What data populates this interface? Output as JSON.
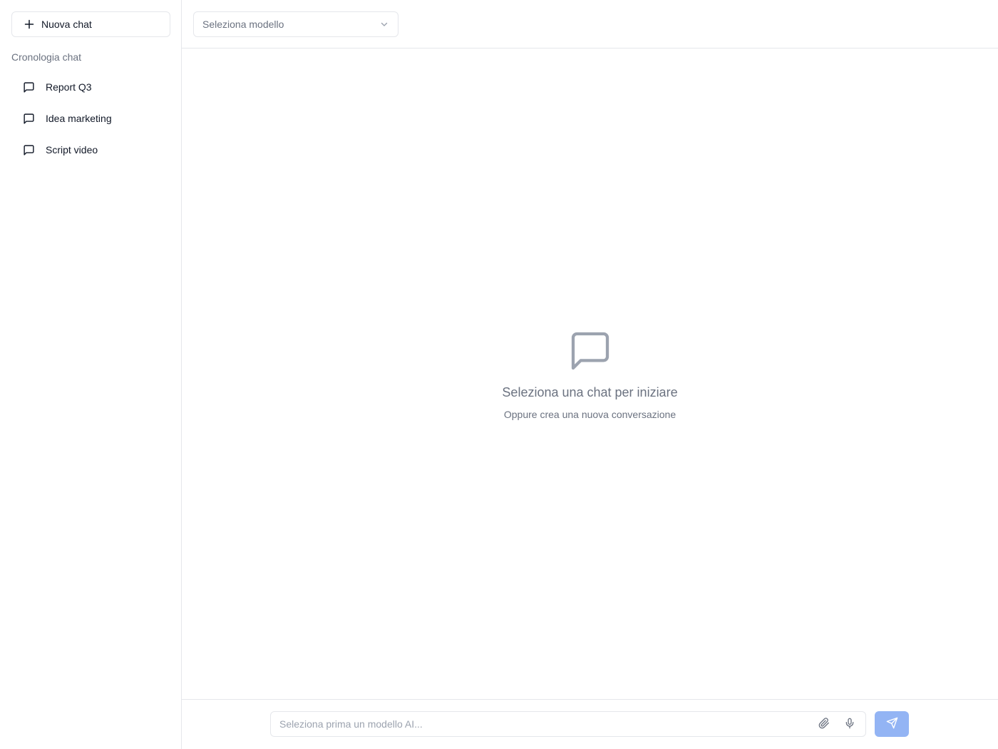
{
  "sidebar": {
    "new_chat_label": "Nuova chat",
    "history_label": "Cronologia chat",
    "items": [
      {
        "label": "Report Q3"
      },
      {
        "label": "Idea marketing"
      },
      {
        "label": "Script video"
      }
    ]
  },
  "header": {
    "model_select_label": "Seleziona modello"
  },
  "empty_state": {
    "title": "Seleziona una chat per iniziare",
    "subtitle": "Oppure crea una nuova conversazione"
  },
  "composer": {
    "placeholder": "Seleziona prima un modello AI...",
    "icons": [
      "paperclip-icon",
      "microphone-icon",
      "send-icon"
    ]
  },
  "colors": {
    "border": "#e5e7eb",
    "muted_text": "#6b7280",
    "send_button_disabled": "#93b4f4"
  }
}
